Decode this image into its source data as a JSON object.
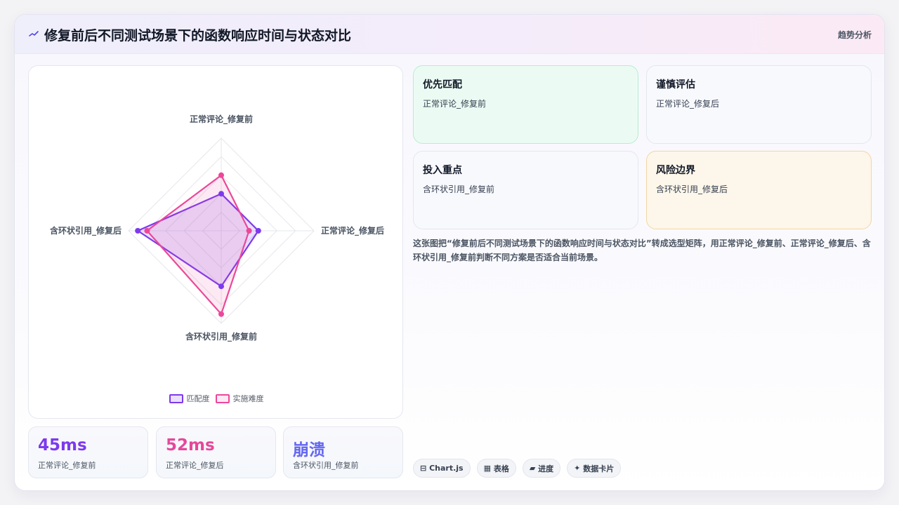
{
  "header": {
    "title": "修复前后不同测试场景下的函数响应时间与状态对比",
    "action_label": "趋势分析"
  },
  "colors": {
    "series_match": "#7c3aed",
    "series_difficulty": "#ec4899",
    "stat_1": "#7c3aed",
    "stat_2": "#e5489a",
    "stat_3": "#6366f1"
  },
  "chart_data": {
    "type": "radar",
    "axes": [
      "正常评论_修复前",
      "正常评论_修复后",
      "含环状引用_修复前",
      "含环状引用_修复后"
    ],
    "range": [
      0,
      5
    ],
    "grid": true,
    "legend_position": "bottom",
    "series": [
      {
        "name": "匹配度",
        "values": [
          2,
          2,
          3,
          4.5
        ],
        "color": "#7c3aed"
      },
      {
        "name": "实施难度",
        "values": [
          3,
          1.5,
          4.5,
          4
        ],
        "color": "#ec4899"
      }
    ]
  },
  "stats": [
    {
      "value": "45ms",
      "label": "正常评论_修复前"
    },
    {
      "value": "52ms",
      "label": "正常评论_修复后"
    },
    {
      "value": "崩溃",
      "label": "含环状引用_修复前"
    }
  ],
  "quadrants": [
    {
      "title": "优先匹配",
      "subtitle": "正常评论_修复前"
    },
    {
      "title": "谨慎评估",
      "subtitle": "正常评论_修复后"
    },
    {
      "title": "投入重点",
      "subtitle": "含环状引用_修复前"
    },
    {
      "title": "风险边界",
      "subtitle": "含环状引用_修复后"
    }
  ],
  "description": "这张图把“修复前后不同测试场景下的函数响应时间与状态对比”转成选型矩阵，用正常评论_修复前、正常评论_修复后、含环状引用_修复前判断不同方案是否适合当前场景。",
  "tags": [
    {
      "icon": "⊟",
      "label": "Chart.js"
    },
    {
      "icon": "▦",
      "label": "表格"
    },
    {
      "icon": "▰",
      "label": "进度"
    },
    {
      "icon": "✦",
      "label": "数据卡片"
    }
  ]
}
